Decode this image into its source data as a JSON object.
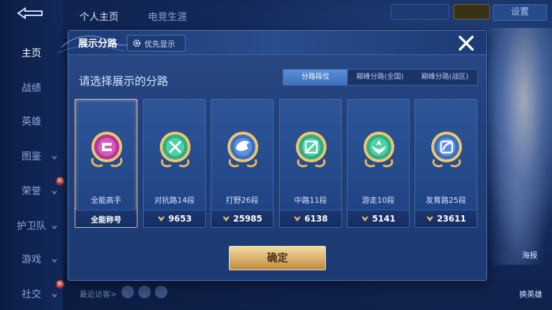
{
  "background": {
    "top_tabs": [
      "个人主页",
      "电竞生涯"
    ],
    "settings_label": "设置",
    "sidebar_items": [
      "主页",
      "战绩",
      "英雄",
      "图鉴",
      "荣誉",
      "护卫队",
      "游戏",
      "社交"
    ],
    "new_badge": "新",
    "recent_visitors_label": "最近访客>",
    "right_buttons": [
      "海报",
      "换英雄"
    ]
  },
  "modal": {
    "title": "展示分路",
    "priority_button": "优先显示",
    "prompt": "请选择展示的分路",
    "segment_tabs": [
      "分路段位",
      "巅峰分路(全国)",
      "巅峰分路(战区)"
    ],
    "active_segment": "分路段位",
    "cards": [
      {
        "role": "全能高手",
        "footer_text": "全能称号",
        "score": null,
        "selected": true,
        "emblem": "all-round-emblem-icon",
        "color": "#b0389a"
      },
      {
        "role": "对抗路14段",
        "score": "9653",
        "selected": false,
        "emblem": "clash-lane-emblem-icon",
        "color": "#2fae88"
      },
      {
        "role": "打野26段",
        "score": "25985",
        "selected": false,
        "emblem": "jungle-emblem-icon",
        "color": "#3b6fc4"
      },
      {
        "role": "中路11段",
        "score": "6138",
        "selected": false,
        "emblem": "mid-lane-emblem-icon",
        "color": "#2fae88"
      },
      {
        "role": "游走10段",
        "score": "5141",
        "selected": false,
        "emblem": "roam-emblem-icon",
        "color": "#2fae88"
      },
      {
        "role": "发育路25段",
        "score": "23611",
        "selected": false,
        "emblem": "farm-lane-emblem-icon",
        "color": "#3b6fc4"
      }
    ],
    "confirm_label": "确定"
  },
  "colors": {
    "accent_gold": "#d9b06a",
    "selected_border": "#e8c38a",
    "panel_blue": "#22407a"
  }
}
